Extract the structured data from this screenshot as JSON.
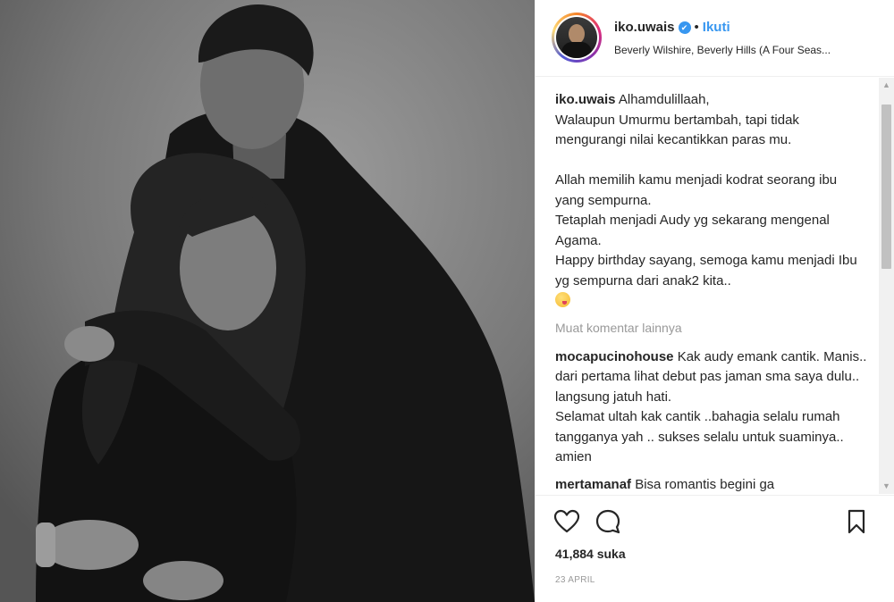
{
  "post": {
    "username": "iko.uwais",
    "verified_mark": "✔",
    "separator": "•",
    "follow_label": "Ikuti",
    "location": "Beverly Wilshire, Beverly Hills (A Four Seas..."
  },
  "caption": {
    "username": "iko.uwais",
    "text": " Alhamdulillaah,\nWalaupun Umurmu bertambah, tapi tidak mengurangi nilai kecantikkan paras mu.\n\nAllah memilih kamu menjadi kodrat seorang ibu yang sempurna.\nTetaplah menjadi Audy yg sekarang mengenal Agama.\nHappy birthday sayang, semoga kamu menjadi Ibu yg sempurna dari anak2 kita..",
    "emoji": "face-savoring-food-emoji"
  },
  "load_more_label": "Muat komentar lainnya",
  "comments": [
    {
      "username": "mocapucinohouse",
      "text": " Kak audy emank cantik. Manis.. dari pertama lihat debut pas jaman sma saya dulu.. langsung jatuh hati.\nSelamat ultah kak cantik ..bahagia selalu rumah tangganya yah .. sukses selalu untuk suaminya.. amien"
    },
    {
      "username": "mertamanaf",
      "text": " Bisa romantis begini ga"
    }
  ],
  "icons": {
    "like": "heart-icon",
    "comment": "speech-bubble-icon",
    "save": "bookmark-icon",
    "verified": "verified-badge-icon"
  },
  "likes_label": "41,884 suka",
  "date_label": "23 APRIL",
  "colors": {
    "link_blue": "#3897f0",
    "text": "#262626",
    "muted": "#999999",
    "border": "#efefef"
  }
}
